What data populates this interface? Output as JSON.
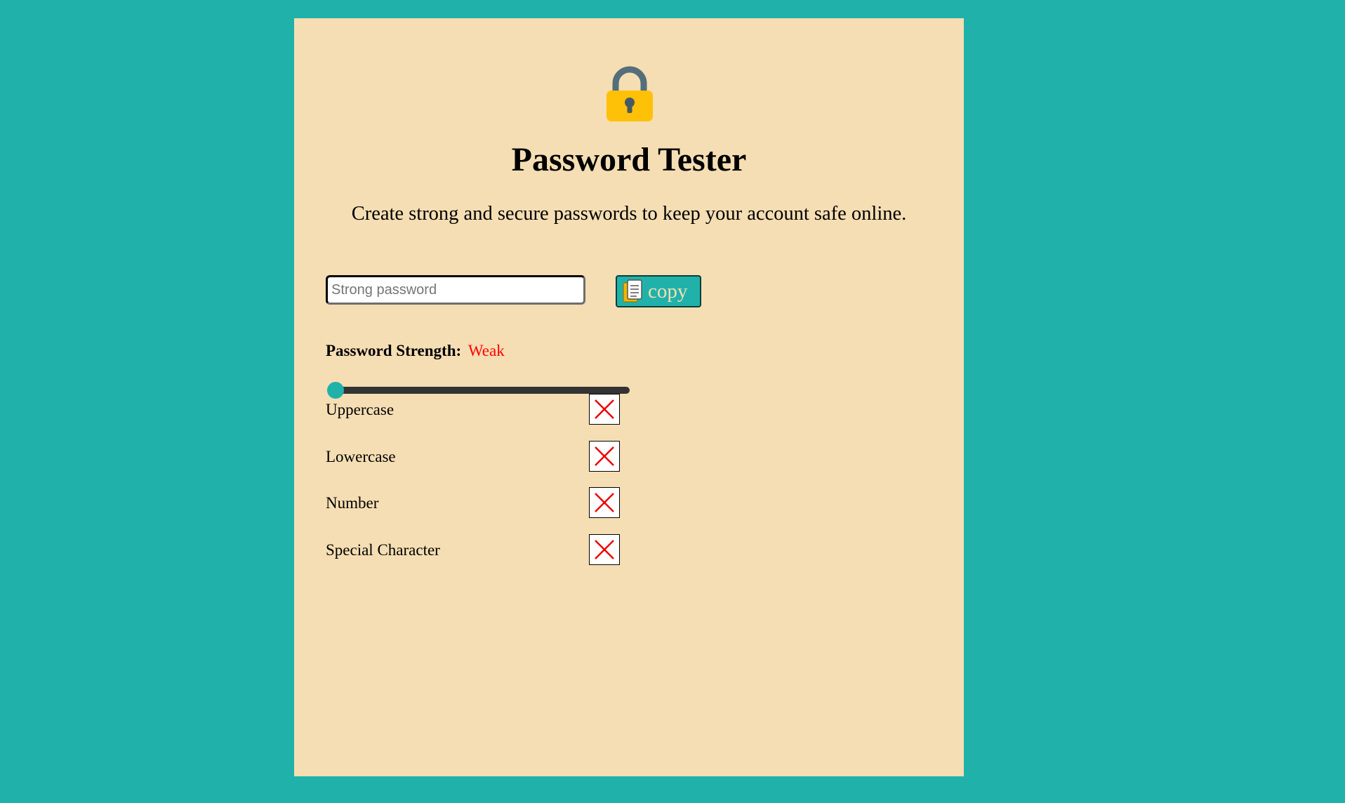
{
  "app": {
    "title": "Password Tester",
    "subtitle": "Create strong and secure passwords to keep your account safe online."
  },
  "icons": {
    "lock": "lock-icon",
    "copy": "clipboard-icon",
    "criteria_unmet": "red-x-icon"
  },
  "password_input": {
    "placeholder": "Strong password",
    "value": ""
  },
  "copy_button": {
    "label": "copy"
  },
  "strength": {
    "label": "Password Strength:",
    "value": "Weak",
    "slider_level": 0
  },
  "criteria": [
    {
      "label": "Uppercase",
      "met": false
    },
    {
      "label": "Lowercase",
      "met": false
    },
    {
      "label": "Number",
      "met": false
    },
    {
      "label": "Special Character",
      "met": false
    }
  ],
  "colors": {
    "background": "#20b2aa",
    "card": "#f5deb3",
    "weak": "#ff0000",
    "slider_track": "#333333",
    "slider_thumb": "#20b2aa"
  }
}
